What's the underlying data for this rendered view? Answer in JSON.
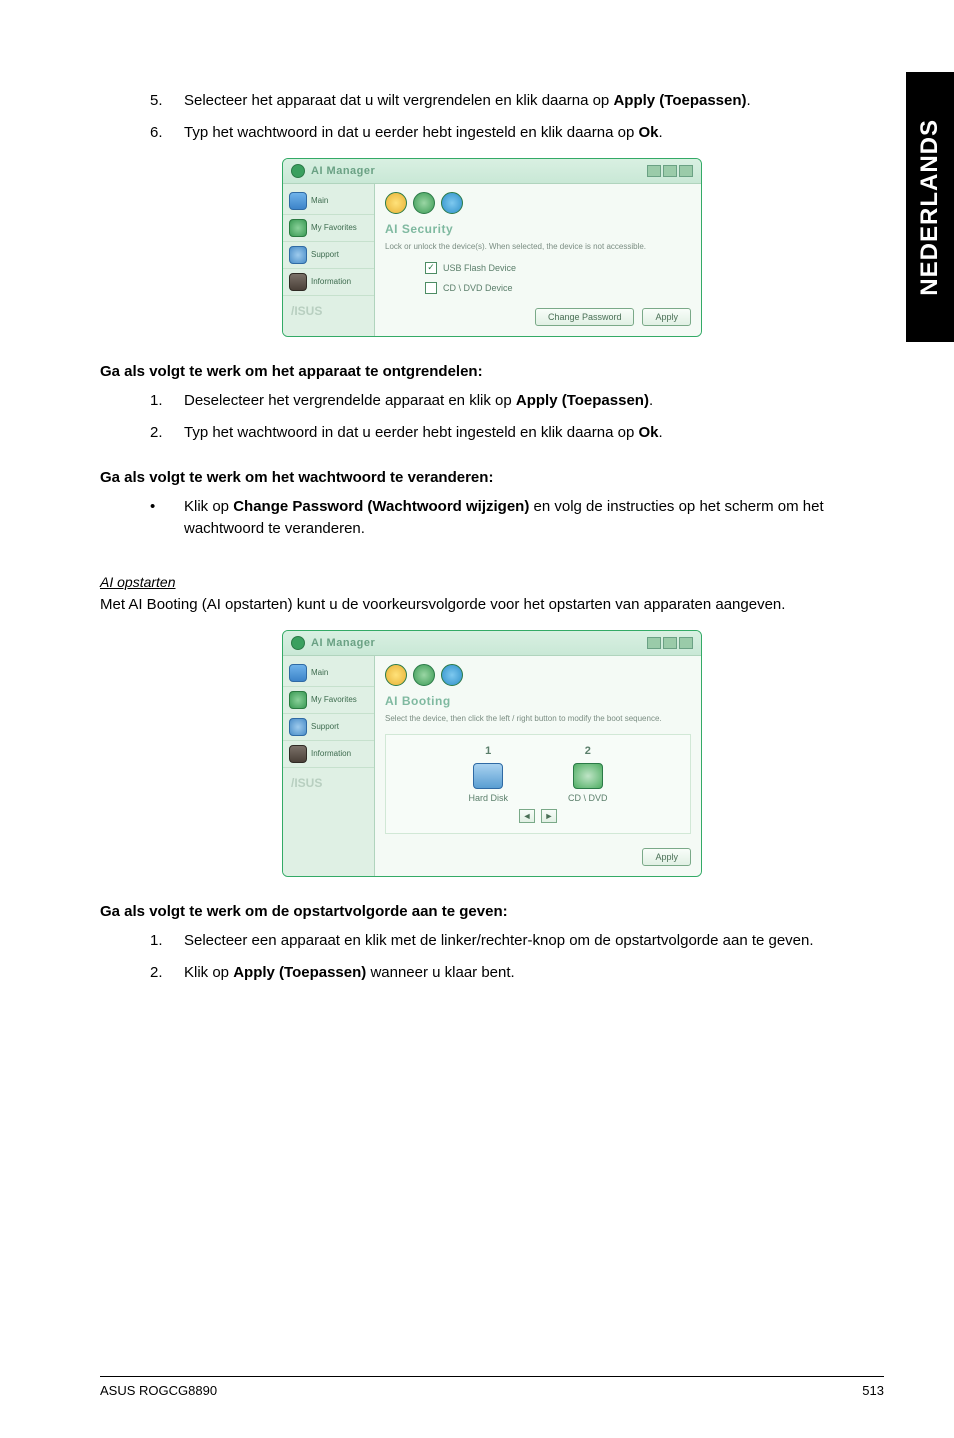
{
  "sideTab": "NEDERLANDS",
  "steps_a": [
    {
      "n": "5.",
      "pre": "Selecteer het apparaat dat u wilt vergrendelen en klik daarna op ",
      "bold": "Apply (Toepassen)",
      "post": "."
    },
    {
      "n": "6.",
      "pre": "Typ het wachtwoord in dat u eerder hebt ingesteld en klik daarna op ",
      "bold": "Ok",
      "post": "."
    }
  ],
  "screenshot1": {
    "title": "AI Manager",
    "side": [
      "Main",
      "My Favorites",
      "Support",
      "Information"
    ],
    "panelTitle": "AI Security",
    "desc": "Lock or unlock the device(s). When selected, the device is not accessible.",
    "opt1": "USB Flash Device",
    "opt2": "CD \\ DVD Device",
    "btn1": "Change Password",
    "btn2": "Apply",
    "brand": "/ISUS"
  },
  "sectionUnlock": "Ga als volgt te werk om het apparaat te ontgrendelen:",
  "steps_b": [
    {
      "n": "1.",
      "pre": "Deselecteer het vergrendelde apparaat en klik op ",
      "bold": "Apply (Toepassen)",
      "post": "."
    },
    {
      "n": "2.",
      "pre": "Typ het wachtwoord in dat u eerder hebt ingesteld en klik daarna op ",
      "bold": "Ok",
      "post": "."
    }
  ],
  "sectionChange": "Ga als volgt te werk om het wachtwoord te veranderen:",
  "change_bullet": {
    "pre": "Klik op ",
    "bold": "Change Password (Wachtwoord wijzigen)",
    "post": " en volg de instructies op het scherm om het wachtwoord te veranderen."
  },
  "aiBootHead": "AI opstarten",
  "aiBootPara": "Met AI Booting (AI opstarten) kunt u de voorkeursvolgorde voor het opstarten van apparaten aangeven.",
  "screenshot2": {
    "title": "AI Manager",
    "side": [
      "Main",
      "My Favorites",
      "Support",
      "Information"
    ],
    "panelTitle": "AI Booting",
    "desc": "Select the device, then click the left / right button to modify the boot sequence.",
    "col1n": "1",
    "col1l": "Hard Disk",
    "col2n": "2",
    "col2l": "CD \\ DVD",
    "btnApply": "Apply",
    "brand": "/ISUS"
  },
  "sectionBoot": "Ga als volgt te werk om de opstartvolgorde aan te geven:",
  "steps_c": [
    {
      "n": "1.",
      "text": "Selecteer een apparaat en klik met de linker/rechter-knop om de opstartvolgorde aan te geven."
    },
    {
      "n": "2.",
      "pre": "Klik op ",
      "bold": "Apply (Toepassen)",
      "post": " wanneer u klaar bent."
    }
  ],
  "footerLeft": "ASUS ROGCG8890",
  "footerRight": "513"
}
